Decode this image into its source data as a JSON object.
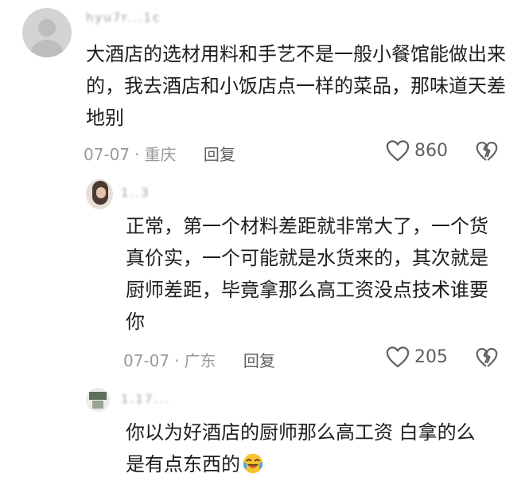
{
  "comments": [
    {
      "author": "hyu7r...1c",
      "text": "大酒店的选材用料和手艺不是一般小餐馆能做出来的，我去酒店和小饭店点一样的菜品，那味道天差地别",
      "date": "07-07",
      "location": "重庆",
      "reply_label": "回复",
      "likes": "860"
    },
    {
      "author": "1..3",
      "text": "正常，第一个材料差距就非常大了，一个货真价实，一个可能就是水货来的，其次就是厨师差距，毕竟拿那么高工资没点技术谁要你",
      "date": "07-07",
      "location": "广东",
      "reply_label": "回复",
      "likes": "205"
    },
    {
      "author": "1.17...",
      "text": "你以为好酒店的厨师那么高工资  白拿的么 是有点东西的",
      "emoji": "crying-laughing-emoji"
    }
  ],
  "meta_separator": "·",
  "icons": {
    "like": "heart-outline-icon",
    "dislike": "broken-heart-outline-icon"
  },
  "colors": {
    "text": "#1e1e1e",
    "meta": "#9a9a9a",
    "icon": "#5f5f5f"
  }
}
